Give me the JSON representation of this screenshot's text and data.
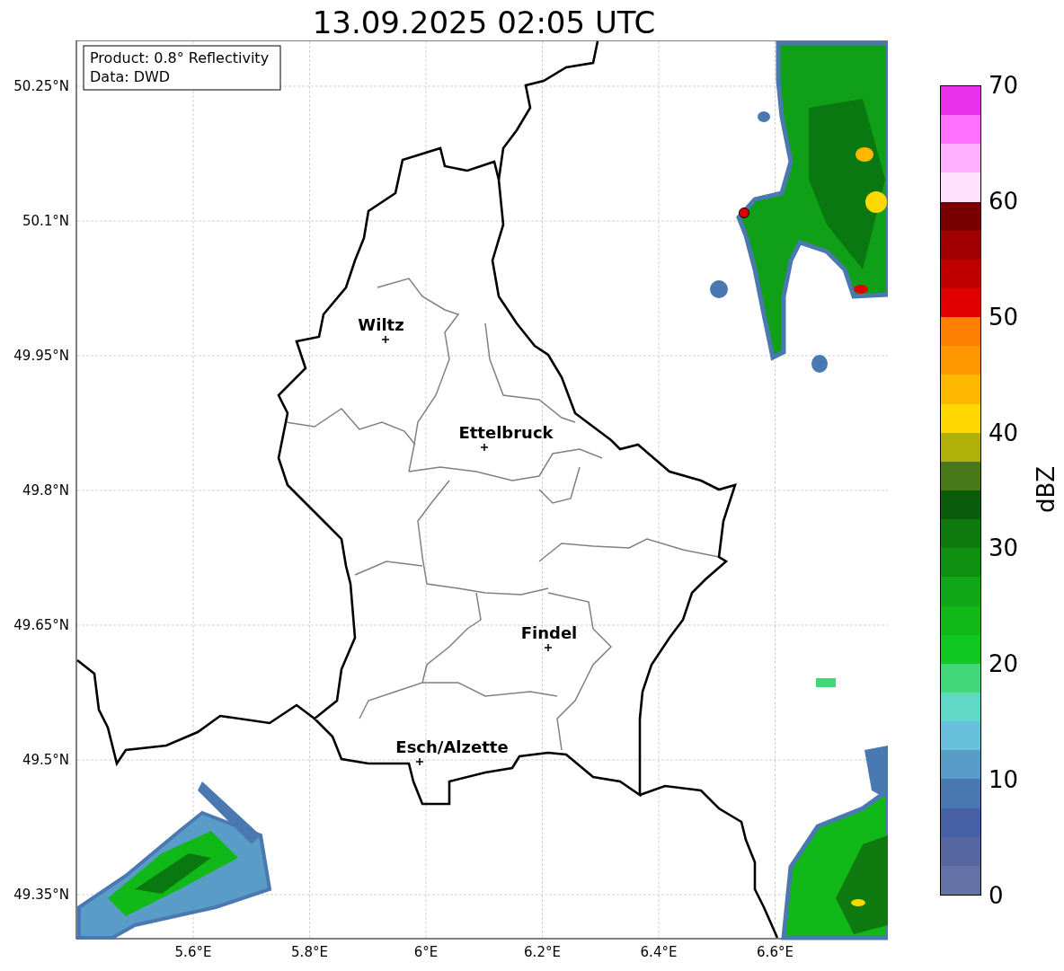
{
  "title": "13.09.2025 02:05 UTC",
  "info_box": {
    "lines": [
      "Product: 0.8° Reflectivity",
      "Data: DWD"
    ]
  },
  "map": {
    "lat_ticks": [
      "50.25°N",
      "50.1°N",
      "49.95°N",
      "49.8°N",
      "49.65°N",
      "49.5°N",
      "49.35°N"
    ],
    "lon_ticks": [
      "5.6°E",
      "5.8°E",
      "6°E",
      "6.2°E",
      "6.4°E",
      "6.6°E"
    ],
    "cities": [
      {
        "name": "Wiltz"
      },
      {
        "name": "Ettelbruck"
      },
      {
        "name": "Findel"
      },
      {
        "name": "Esch/Alzette"
      }
    ]
  },
  "colorbar": {
    "label": "dBZ",
    "ticks": [
      "70",
      "60",
      "50",
      "40",
      "30",
      "20",
      "10",
      "0"
    ],
    "segments": [
      {
        "color": "#e830e8"
      },
      {
        "color": "#ff70ff"
      },
      {
        "color": "#ffb0ff"
      },
      {
        "color": "#ffe0ff"
      },
      {
        "color": "#780000"
      },
      {
        "color": "#a00000"
      },
      {
        "color": "#c00000"
      },
      {
        "color": "#e00000"
      },
      {
        "color": "#ff8000"
      },
      {
        "color": "#ff9800"
      },
      {
        "color": "#ffb800"
      },
      {
        "color": "#ffd800"
      },
      {
        "color": "#b0b008"
      },
      {
        "color": "#487818"
      },
      {
        "color": "#0a5c0a"
      },
      {
        "color": "#0e7a10"
      },
      {
        "color": "#109010"
      },
      {
        "color": "#10a818"
      },
      {
        "color": "#10b818"
      },
      {
        "color": "#10c820"
      },
      {
        "color": "#40d878"
      },
      {
        "color": "#60d8c8"
      },
      {
        "color": "#68c0dc"
      },
      {
        "color": "#5a9cc8"
      },
      {
        "color": "#4a78b0"
      },
      {
        "color": "#4560a5"
      },
      {
        "color": "#5566a0"
      },
      {
        "color": "#6272a6"
      }
    ]
  }
}
